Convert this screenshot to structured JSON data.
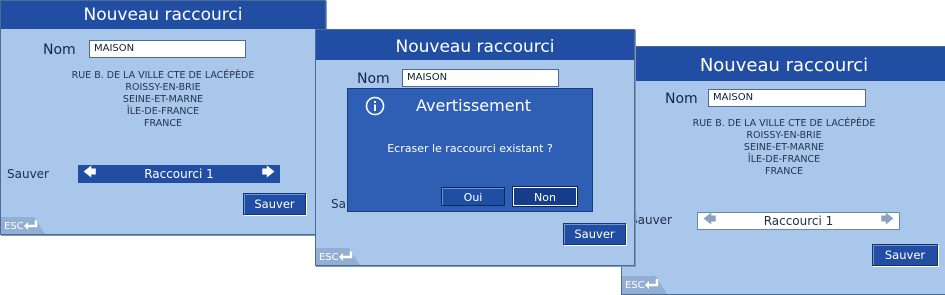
{
  "screen1": {
    "title": "Nouveau raccourci",
    "name_label": "Nom",
    "name_value": "MAISON",
    "address": [
      "RUE B. DE LA VILLE CTE DE LACÉPÈDE",
      "ROISSY-EN-BRIE",
      "SEINE-ET-MARNE",
      "ÎLE-DE-FRANCE",
      "FRANCE"
    ],
    "save_label": "Sauver",
    "selector_value": "Raccourci 1",
    "sauver_button": "Sauver",
    "esc_label": "ESC"
  },
  "screen2": {
    "title": "Nouveau raccourci",
    "name_label": "Nom",
    "name_value": "MAISON",
    "save_label_partial": "Sau",
    "sauver_button": "Sauver",
    "esc_label": "ESC",
    "dialog": {
      "title": "Avertissement",
      "message": "Ecraser le raccourci existant ?",
      "yes_button": "Oui",
      "no_button": "Non",
      "icon": "info-icon"
    }
  },
  "screen3": {
    "title": "Nouveau raccourci",
    "name_label": "Nom",
    "name_value": "MAISON",
    "address": [
      "RUE B. DE LA VILLE CTE DE LACÉPÈDE",
      "ROISSY-EN-BRIE",
      "SEINE-ET-MARNE",
      "ÎLE-DE-FRANCE",
      "FRANCE"
    ],
    "save_label": "Sauver",
    "selector_value": "Raccourci 1",
    "sauver_button": "Sauver",
    "esc_label": "ESC"
  },
  "colors": {
    "background": "#a9c7ea",
    "title_bar": "#214ea3",
    "dialog": "#2e5fb5"
  }
}
